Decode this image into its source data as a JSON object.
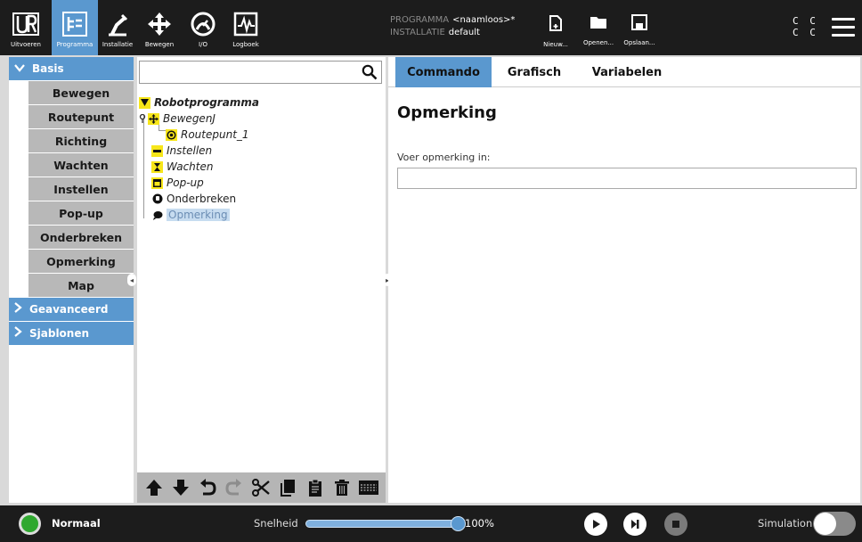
{
  "topbar": {
    "nav": [
      {
        "id": "run",
        "label": "Uitvoeren",
        "icon": "ur-logo-icon"
      },
      {
        "id": "program",
        "label": "Programma",
        "icon": "program-icon",
        "active": true
      },
      {
        "id": "installation",
        "label": "Installatie",
        "icon": "robot-arm-icon"
      },
      {
        "id": "move",
        "label": "Bewegen",
        "icon": "move-arrows-icon"
      },
      {
        "id": "io",
        "label": "I/O",
        "icon": "io-gauge-icon"
      },
      {
        "id": "log",
        "label": "Logboek",
        "icon": "log-chart-icon"
      }
    ],
    "program_key": "PROGRAMMA",
    "program_value": "<naamloos>*",
    "installation_key": "INSTALLATIE",
    "installation_value": "default",
    "file_buttons": [
      {
        "id": "new",
        "label": "Nieuw...",
        "icon": "new-file-icon"
      },
      {
        "id": "open",
        "label": "Openen...",
        "icon": "folder-icon"
      },
      {
        "id": "save",
        "label": "Opslaan...",
        "icon": "save-icon"
      }
    ],
    "cc_line1": "C C",
    "cc_line2": "C C"
  },
  "leftnav": {
    "basis_label": "Basis",
    "basis_items": [
      "Bewegen",
      "Routepunt",
      "Richting",
      "Wachten",
      "Instellen",
      "Pop-up",
      "Onderbreken",
      "Opmerking",
      "Map"
    ],
    "advanced_label": "Geavanceerd",
    "templates_label": "Sjablonen"
  },
  "tree": {
    "search_placeholder": "",
    "nodes": {
      "root": "Robotprogramma",
      "movej": "BewegenJ",
      "waypoint": "Routepunt_1",
      "set": "Instellen",
      "wait": "Wachten",
      "popup": "Pop-up",
      "halt": "Onderbreken",
      "comment": "Opmerking"
    }
  },
  "right": {
    "tabs": [
      "Commando",
      "Grafisch",
      "Variabelen"
    ],
    "active_tab": 0,
    "title": "Opmerking",
    "prompt": "Voer opmerking in:",
    "input_value": ""
  },
  "bottombar": {
    "status": "Normaal",
    "status_color": "#2fa82f",
    "speed_label": "Snelheid",
    "speed_value": "100%",
    "speed_fraction": 1.0,
    "simulation_label": "Simulation",
    "simulation_on": false
  },
  "colors": {
    "accent": "#5a98cf",
    "topbar_bg": "#1c1c1c",
    "node_yellow": "#f7e61a"
  }
}
